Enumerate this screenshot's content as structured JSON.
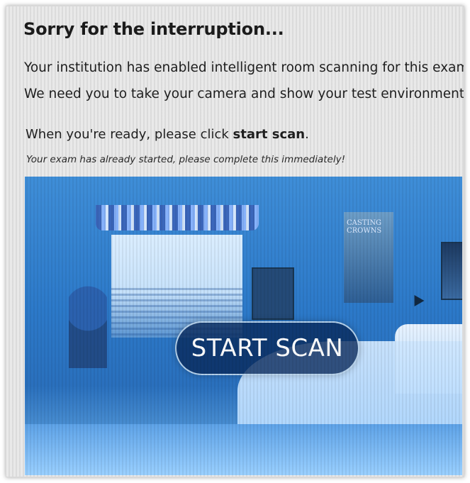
{
  "dialog": {
    "title": "Sorry for the interruption...",
    "line1": "Your institution has enabled intelligent room scanning for this exam.",
    "line2": "We need you to take your camera and show your test environment.",
    "ready_prefix": "When you're ready, please click ",
    "ready_bold": "start scan",
    "ready_suffix": ".",
    "warning": "Your exam has already started, please complete this immediately!"
  },
  "camera": {
    "poster_text": "CASTING CROWNS",
    "start_button_label": "START SCAN"
  },
  "colors": {
    "overlay_blue": "#2c79c9",
    "button_bg": "#08285a",
    "text": "#1f1f1f"
  }
}
